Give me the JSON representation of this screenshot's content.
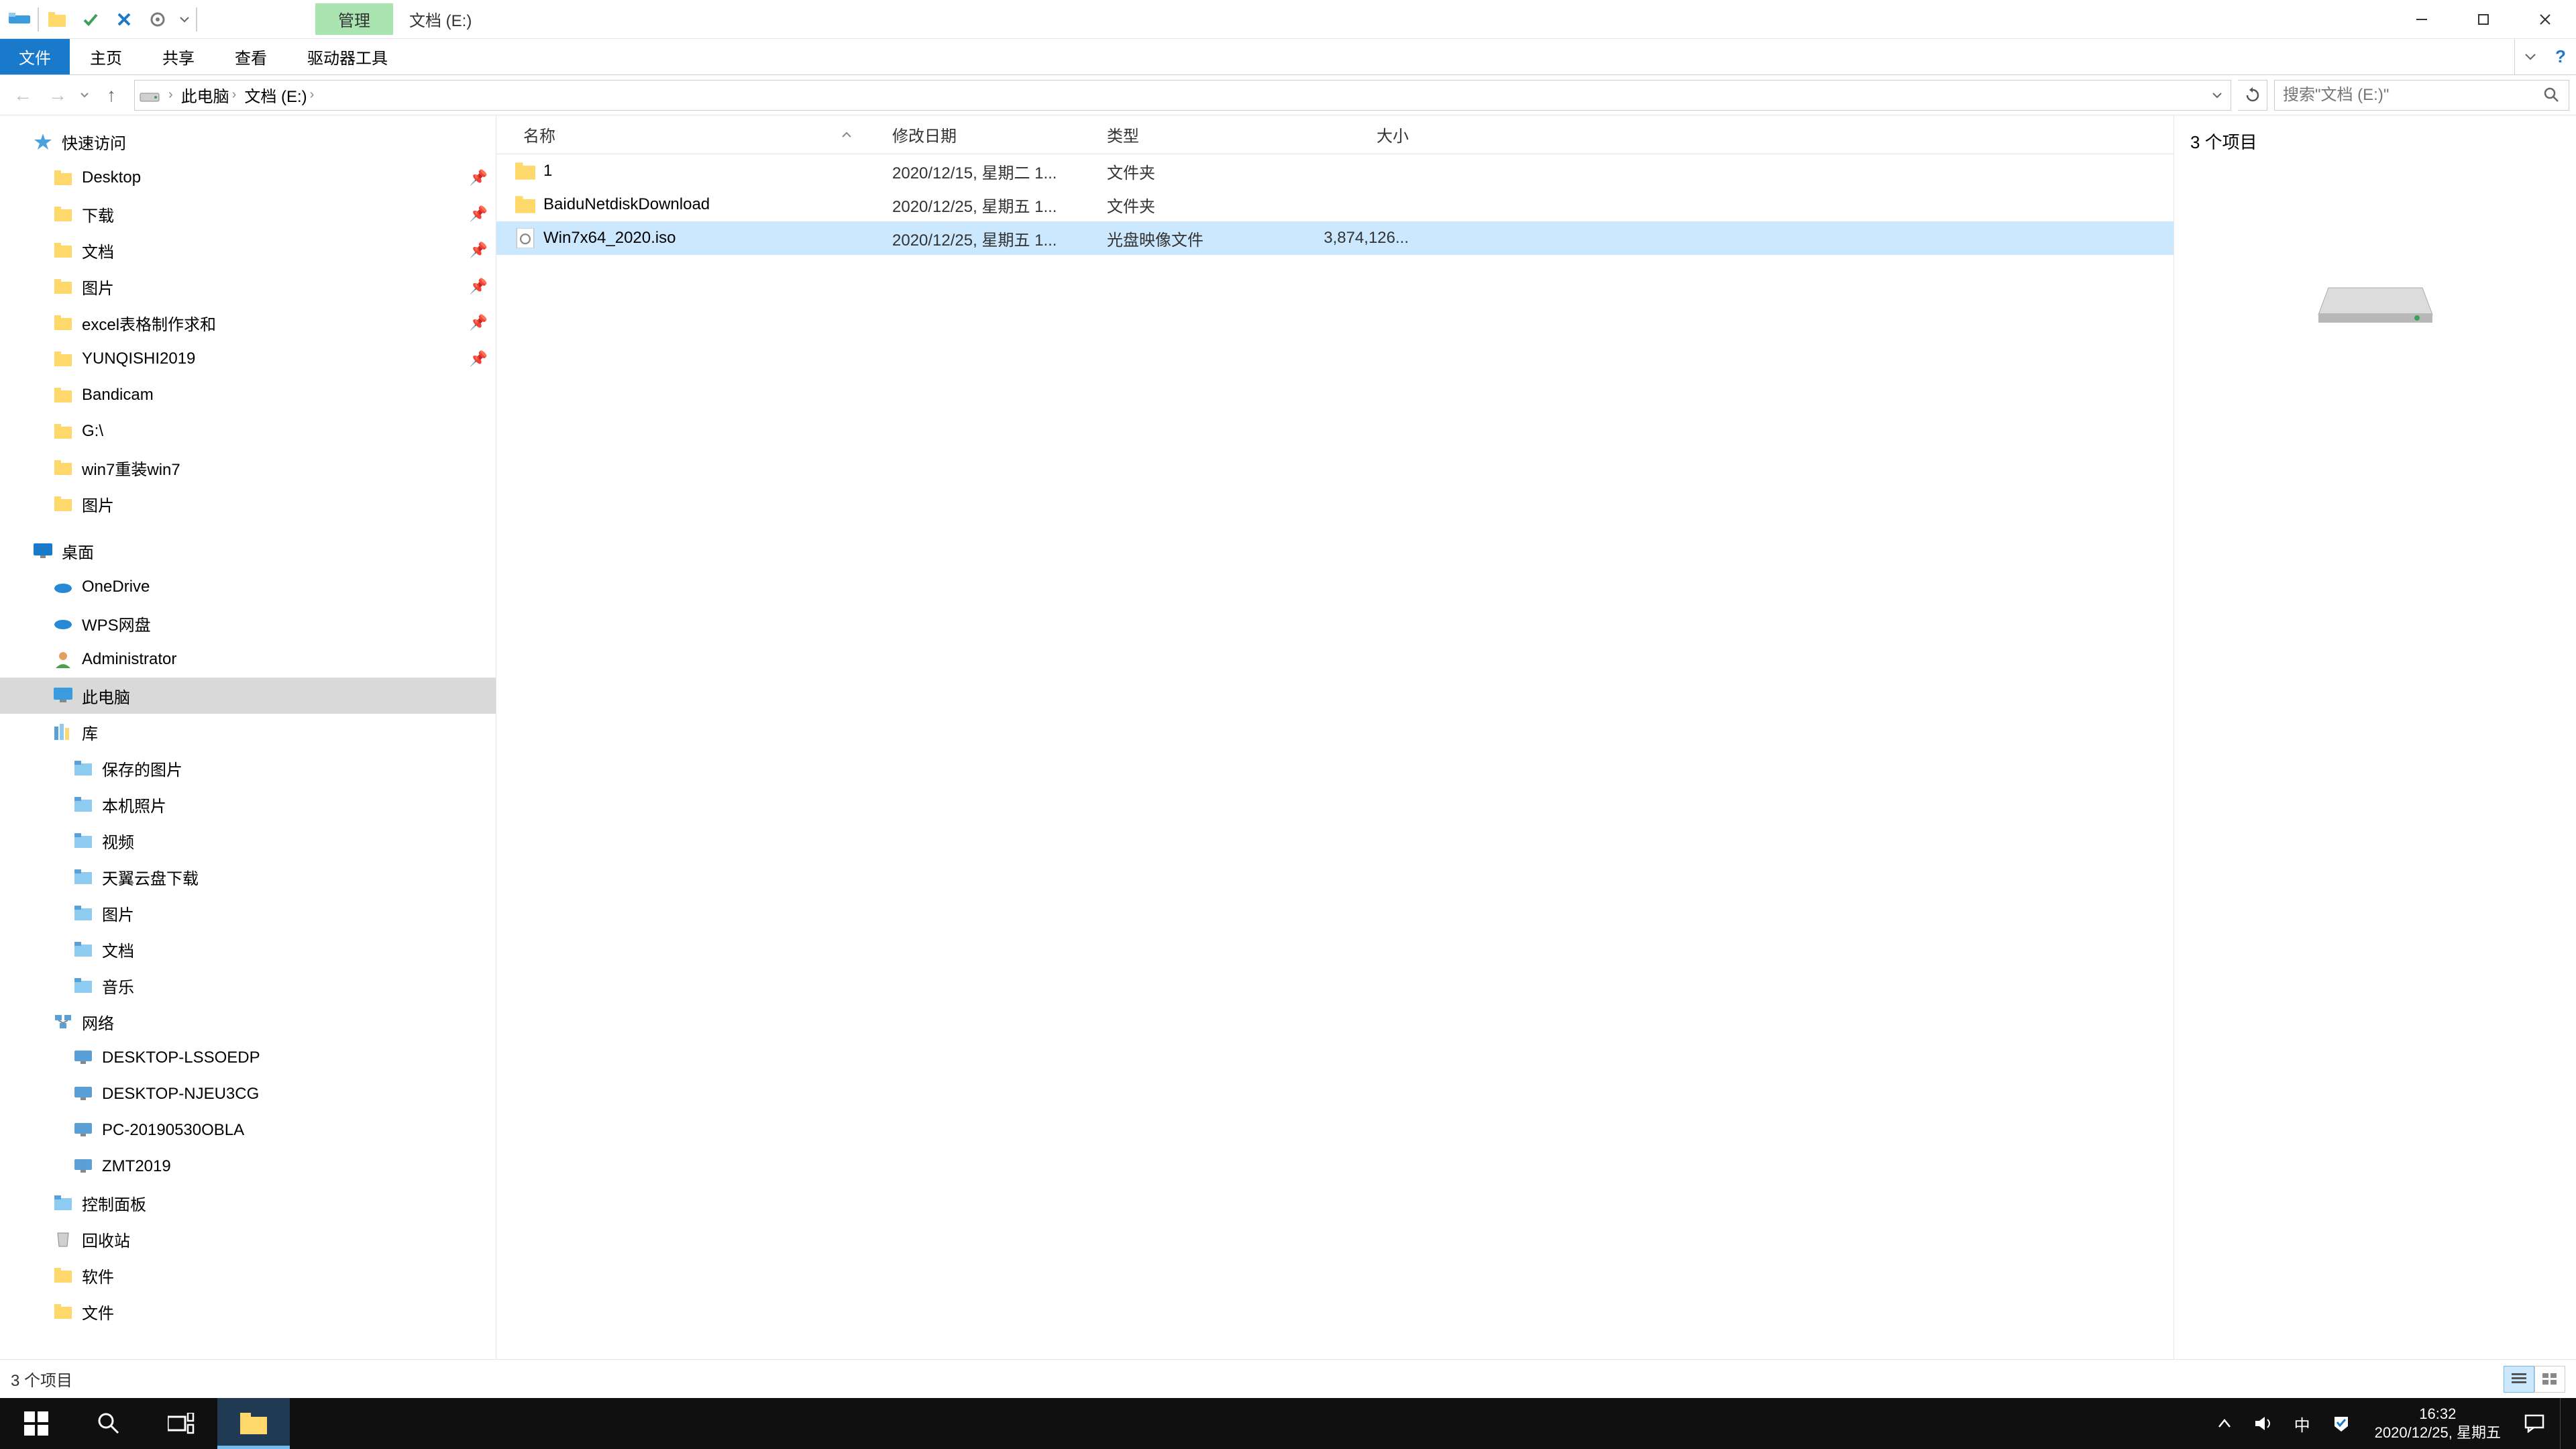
{
  "titlebar": {
    "context_tab": "管理",
    "location_tab": "文档 (E:)"
  },
  "ribbon": {
    "file": "文件",
    "home": "主页",
    "share": "共享",
    "view": "查看",
    "drive_tools": "驱动器工具"
  },
  "nav": {
    "breadcrumb": [
      "此电脑",
      "文档 (E:)"
    ],
    "search_placeholder": "搜索\"文档 (E:)\""
  },
  "tree": {
    "quick_access": "快速访问",
    "qa_items": [
      {
        "label": "Desktop",
        "pin": true
      },
      {
        "label": "下载",
        "pin": true
      },
      {
        "label": "文档",
        "pin": true
      },
      {
        "label": "图片",
        "pin": true
      },
      {
        "label": "excel表格制作求和",
        "pin": true
      },
      {
        "label": "YUNQISHI2019",
        "pin": true
      },
      {
        "label": "Bandicam",
        "pin": false
      },
      {
        "label": "G:\\",
        "pin": false
      },
      {
        "label": "win7重装win7",
        "pin": false
      },
      {
        "label": "图片",
        "pin": false
      }
    ],
    "desktop": "桌面",
    "desktop_items": [
      "OneDrive",
      "WPS网盘",
      "Administrator",
      "此电脑",
      "库"
    ],
    "lib_items": [
      "保存的图片",
      "本机照片",
      "视频",
      "天翼云盘下载",
      "图片",
      "文档",
      "音乐"
    ],
    "network": "网络",
    "net_items": [
      "DESKTOP-LSSOEDP",
      "DESKTOP-NJEU3CG",
      "PC-20190530OBLA",
      "ZMT2019"
    ],
    "control_panel": "控制面板",
    "recycle_bin": "回收站",
    "software": "软件",
    "documents": "文件"
  },
  "columns": {
    "name": "名称",
    "date": "修改日期",
    "type": "类型",
    "size": "大小"
  },
  "files": [
    {
      "name": "1",
      "date": "2020/12/15, 星期二 1...",
      "type": "文件夹",
      "size": "",
      "icon": "folder"
    },
    {
      "name": "BaiduNetdiskDownload",
      "date": "2020/12/25, 星期五 1...",
      "type": "文件夹",
      "size": "",
      "icon": "folder"
    },
    {
      "name": "Win7x64_2020.iso",
      "date": "2020/12/25, 星期五 1...",
      "type": "光盘映像文件",
      "size": "3,874,126...",
      "icon": "iso",
      "selected": true
    }
  ],
  "preview": {
    "count_label": "3 个项目"
  },
  "statusbar": {
    "text": "3 个项目"
  },
  "taskbar": {
    "time": "16:32",
    "date": "2020/12/25, 星期五",
    "ime": "中"
  }
}
